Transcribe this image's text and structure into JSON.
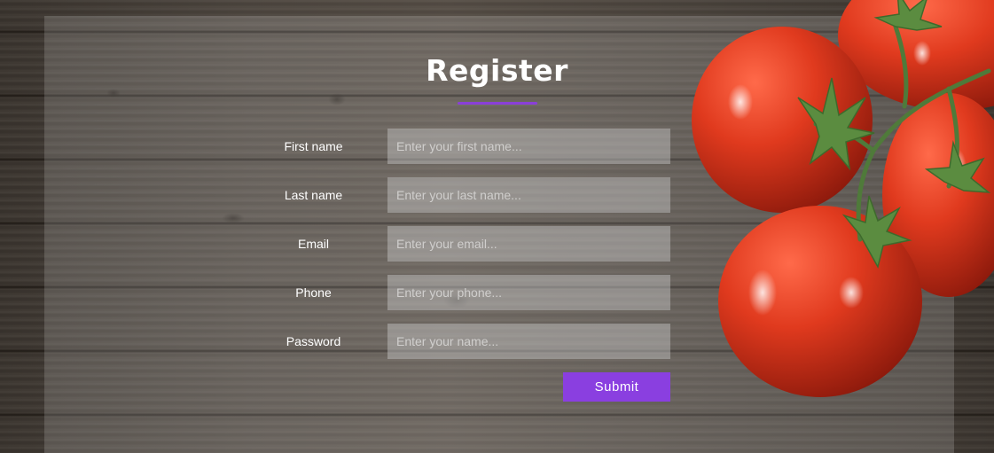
{
  "page": {
    "title": "Register",
    "accent_color": "#8a3fe0"
  },
  "form": {
    "fields": [
      {
        "label": "First name",
        "placeholder": "Enter your first name...",
        "value": ""
      },
      {
        "label": "Last name",
        "placeholder": "Enter your last name...",
        "value": ""
      },
      {
        "label": "Email",
        "placeholder": "Enter your email...",
        "value": ""
      },
      {
        "label": "Phone",
        "placeholder": "Enter your phone...",
        "value": ""
      },
      {
        "label": "Password",
        "placeholder": "Enter your name...",
        "value": ""
      }
    ],
    "submit_label": "Submit"
  },
  "background": {
    "image": "wooden-table-with-tomatoes"
  }
}
